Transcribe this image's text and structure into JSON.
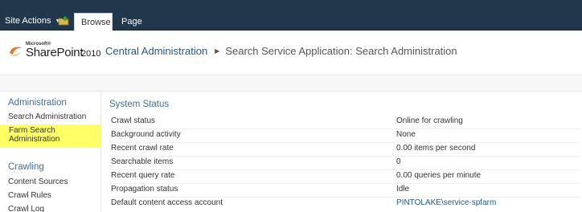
{
  "ribbon": {
    "site_actions_label": "Site Actions",
    "navigate_up_icon": "folder-up-icon",
    "tabs": [
      {
        "label": "Browse",
        "selected": true
      },
      {
        "label": "Page",
        "selected": false
      }
    ],
    "background_color": "#21374c"
  },
  "header": {
    "logo": {
      "microsoft": "Microsoft®",
      "product": "SharePoint",
      "year": "2010"
    },
    "breadcrumb": {
      "root": "Central Administration",
      "separator_icon": "triangle-right-icon",
      "current": "Search Service Application: Search Administration"
    }
  },
  "leftnav": {
    "groups": [
      {
        "heading": "Administration",
        "items": [
          {
            "label": "Search Administration",
            "highlighted": false
          },
          {
            "label": "Farm Search Administration",
            "highlighted": true
          }
        ]
      },
      {
        "heading": "Crawling",
        "items": [
          {
            "label": "Content Sources"
          },
          {
            "label": "Crawl Rules"
          },
          {
            "label": "Crawl Log"
          }
        ]
      }
    ],
    "highlight_color": "#ffff66"
  },
  "main": {
    "section_title": "System Status",
    "rows": [
      {
        "label": "Crawl status",
        "value": "Online for crawling",
        "is_link": false
      },
      {
        "label": "Background activity",
        "value": "None",
        "is_link": false
      },
      {
        "label": "Recent crawl rate",
        "value": "0.00 items per second",
        "is_link": false
      },
      {
        "label": "Searchable items",
        "value": "0",
        "is_link": false
      },
      {
        "label": "Recent query rate",
        "value": "0.00 queries per minute",
        "is_link": false
      },
      {
        "label": "Propagation status",
        "value": "Idle",
        "is_link": false
      },
      {
        "label": "Default content access account",
        "value": "PINTOLAKE\\service-spfarm",
        "is_link": true
      }
    ],
    "link_color": "#21598f",
    "heading_color": "#3b6fa0"
  }
}
